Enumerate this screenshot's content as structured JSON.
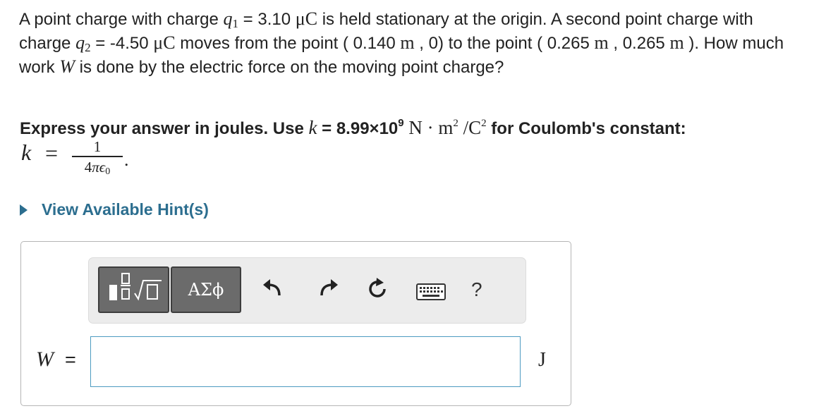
{
  "problem": {
    "t1": "A point charge with charge ",
    "q1_sym": "q",
    "q1_sub": "1",
    "t2": " = 3.10 ",
    "unit_mu1": "μC",
    "t3": " is held stationary at the origin. A second point charge with charge ",
    "q2_sym": "q",
    "q2_sub": "2",
    "t4": " = -4.50 ",
    "unit_mu2": "μC",
    "t5": " moves from the point ( 0.140 ",
    "unit_m1": "m",
    "t6": " , 0) to the point ( 0.265 ",
    "unit_m2": "m",
    "t7": " , 0.265 ",
    "unit_m3": "m",
    "t8": " ). How much work ",
    "w_sym": "W",
    "t9": " is done by the electric force on the moving point charge?"
  },
  "instructions": {
    "t1": "Express your answer in joules. Use ",
    "k_sym": "k",
    "t2": " = 8.99×10",
    "exp9": "9",
    "units_a": " N · m",
    "exp_m": "2",
    "units_b": " /C",
    "exp_c": "2",
    "t3": " for Coulomb's constant:"
  },
  "k_formula": {
    "k": "k",
    "equals": "=",
    "numerator": "1",
    "den_a": "4",
    "den_pi": "π",
    "den_eps": "ϵ",
    "den_sub": "0",
    "end": "."
  },
  "hint": {
    "label": "View Available Hint(s)"
  },
  "toolbar": {
    "greek_label": "ΑΣϕ",
    "help_label": "?",
    "icons": [
      "templates-icon",
      "greek-symbols-icon",
      "undo-icon",
      "redo-icon",
      "reset-icon",
      "keyboard-icon",
      "help-icon"
    ]
  },
  "answer": {
    "variable": "W",
    "equals": "=",
    "value": "",
    "unit": "J"
  },
  "colors": {
    "link": "#2c6e8f",
    "input_border": "#4d9bc1",
    "toolbar_bg": "#ececec",
    "button_bg": "#6b6b6b"
  }
}
